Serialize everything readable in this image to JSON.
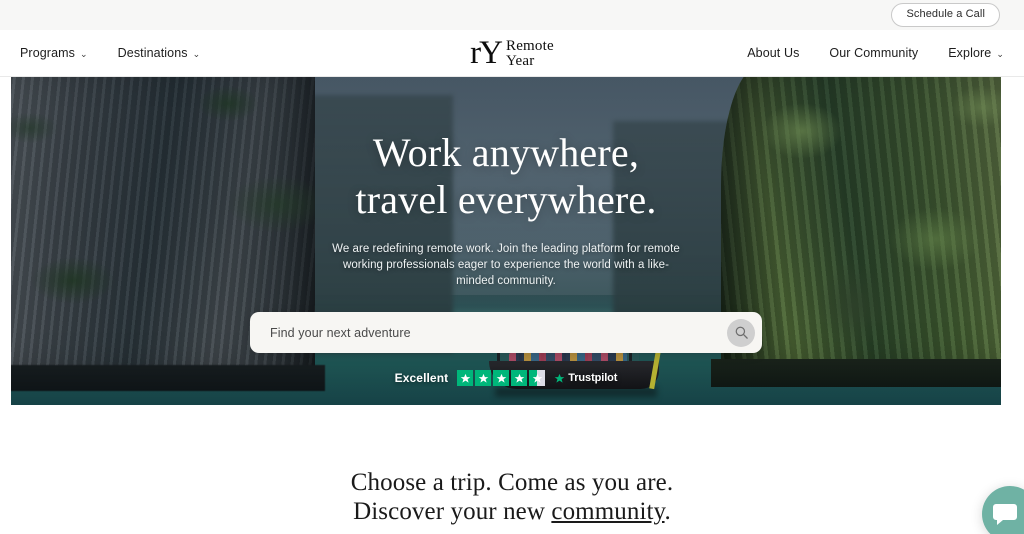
{
  "utility_bar": {
    "schedule_label": "Schedule a Call"
  },
  "nav": {
    "left_items": [
      {
        "label": "Programs",
        "has_caret": true,
        "caret": "⌄"
      },
      {
        "label": "Destinations",
        "has_caret": true,
        "caret": "⌄"
      }
    ],
    "right_items": [
      {
        "label": "About Us",
        "has_caret": false,
        "caret": ""
      },
      {
        "label": "Our Community",
        "has_caret": false,
        "caret": ""
      },
      {
        "label": "Explore",
        "has_caret": true,
        "caret": "⌄"
      }
    ]
  },
  "logo": {
    "monogram": "rY",
    "word_line1": "Remote",
    "word_line2": "Year"
  },
  "hero": {
    "title_line1": "Work anywhere,",
    "title_line2": "travel everywhere.",
    "subtitle": "We are redefining remote work. Join the leading platform for remote working professionals eager to experience the world with a like-minded community.",
    "search_placeholder": "Find your next adventure",
    "search_value": "",
    "search_icon": "search-icon",
    "trustpilot": {
      "rating_label": "Excellent",
      "brand": "Trustpilot",
      "stars_total": 5,
      "stars_filled": 4,
      "has_half_star": true,
      "star_color": "#00b67a",
      "star_empty_color": "#dcdce6"
    }
  },
  "section": {
    "title_line1": "Choose a trip. Come as you are.",
    "title_line2_prefix": "Discover your new ",
    "title_line2_link": "community",
    "title_line2_suffix": "."
  },
  "chat": {
    "icon": "chat-bubble-icon",
    "color": "#6fb2a4"
  },
  "colors": {
    "utility_bar_bg": "#f7f7f6",
    "nav_bg": "#ffffff",
    "page_bg": "#ffffff",
    "text_dark": "#1a1a1a",
    "search_bg": "#f7f6f3",
    "search_button_bg": "#cfcfcf"
  }
}
